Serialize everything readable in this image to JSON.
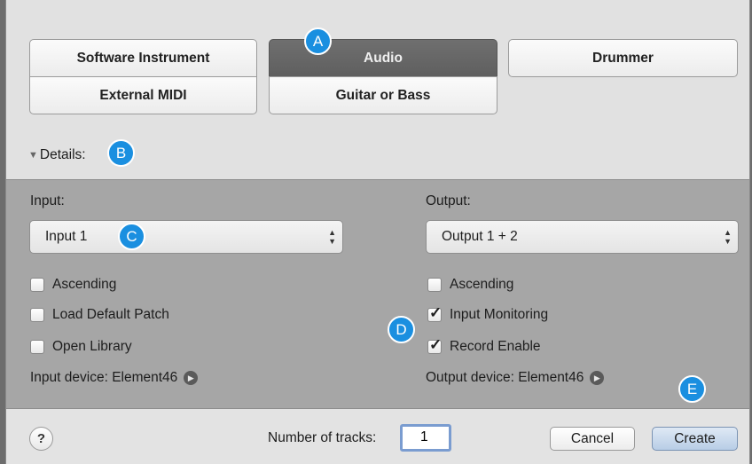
{
  "track_types": {
    "software_instrument": "Software Instrument",
    "audio": "Audio",
    "drummer": "Drummer",
    "external_midi": "External MIDI",
    "guitar_or_bass": "Guitar or Bass",
    "selected": "Audio"
  },
  "details": {
    "label": "Details:",
    "disclosure_icon": "triangle-down-icon"
  },
  "input": {
    "label": "Input:",
    "value": "Input 1",
    "ascending": {
      "label": "Ascending",
      "checked": false
    },
    "load_default_patch": {
      "label": "Load Default Patch",
      "checked": false
    },
    "open_library": {
      "label": "Open Library",
      "checked": false
    },
    "device": "Input device: Element46"
  },
  "output": {
    "label": "Output:",
    "value": "Output 1 + 2",
    "ascending": {
      "label": "Ascending",
      "checked": false
    },
    "input_monitoring": {
      "label": "Input Monitoring",
      "checked": true
    },
    "record_enable": {
      "label": "Record Enable",
      "checked": true
    },
    "device": "Output device: Element46"
  },
  "footer": {
    "help": "?",
    "number_of_tracks_label": "Number of tracks:",
    "number_of_tracks": "1",
    "cancel": "Cancel",
    "create": "Create"
  },
  "callouts": {
    "a": "A",
    "b": "B",
    "c": "C",
    "d": "D",
    "e": "E"
  },
  "colors": {
    "callout": "#1a8fe0",
    "selected_type": "#656565",
    "details_bg": "#a6a6a6",
    "default_button": "#c4d6ec"
  }
}
